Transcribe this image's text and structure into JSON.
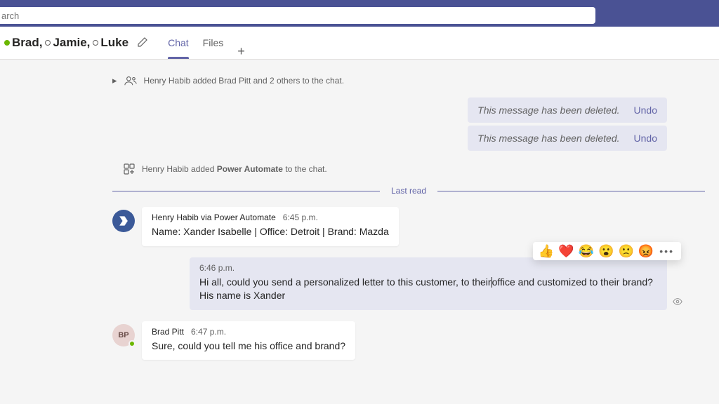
{
  "search": {
    "placeholder": "arch"
  },
  "header": {
    "participants": [
      {
        "name": "Brad,",
        "presence": "online"
      },
      {
        "name": "Jamie,",
        "presence": "offline"
      },
      {
        "name": "Luke",
        "presence": "offline"
      }
    ],
    "tabs": {
      "chat": "Chat",
      "files": "Files"
    }
  },
  "system1": {
    "prefix": "Henry Habib added Brad Pitt and 2 others to the chat."
  },
  "deleted": {
    "text": "This message has been deleted.",
    "undo": "Undo"
  },
  "system2": {
    "prefix": "Henry Habib added ",
    "bold": "Power Automate",
    "suffix": " to the chat."
  },
  "last_read": "Last read",
  "msg1": {
    "name": "Henry Habib via Power Automate",
    "time": "6:45 p.m.",
    "content": "Name: Xander Isabelle | Office: Detroit | Brand: Mazda"
  },
  "self_msg": {
    "time": "6:46 p.m.",
    "content_a": "Hi all, could you send a personalized letter to this customer, to their",
    "content_b": "office and customized to their brand? His name is Xander"
  },
  "msg2": {
    "name": "Brad Pitt",
    "time": "6:47 p.m.",
    "initials": "BP",
    "content": "Sure, could you tell me his office and brand?"
  },
  "reactions": {
    "like": "👍",
    "heart": "❤️",
    "laugh": "😂",
    "surprised": "😮",
    "sad": "🙁",
    "angry": "😡"
  }
}
